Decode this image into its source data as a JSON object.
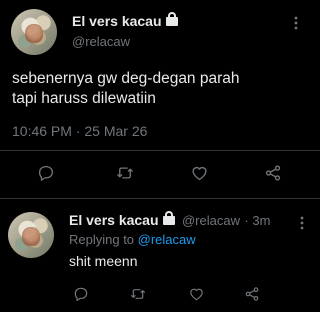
{
  "main_tweet": {
    "author_name": "El vers kacau",
    "author_handle": "@relacaw",
    "text_line1": "sebenernya gw deg-degan parah",
    "text_line2": "tapi haruss dilewatiin",
    "timestamp": "10:46 PM · 25 Mar 26",
    "actions": [
      "reply-icon",
      "retweet-icon",
      "like-icon",
      "share-icon"
    ]
  },
  "reply": {
    "author_name": "El vers kacau",
    "author_handle": "@relacaw",
    "time": "· 3m",
    "replying_to_prefix": "Replying to ",
    "replying_to_handle": "@relacaw",
    "text": "shit meenn",
    "actions": [
      "reply-icon",
      "retweet-icon",
      "like-icon",
      "share-icon"
    ]
  },
  "colors": {
    "background": "#000000",
    "text": "#e7e9ea",
    "secondary": "#71767b",
    "accent": "#1d9bf0",
    "divider": "#2f3336"
  }
}
